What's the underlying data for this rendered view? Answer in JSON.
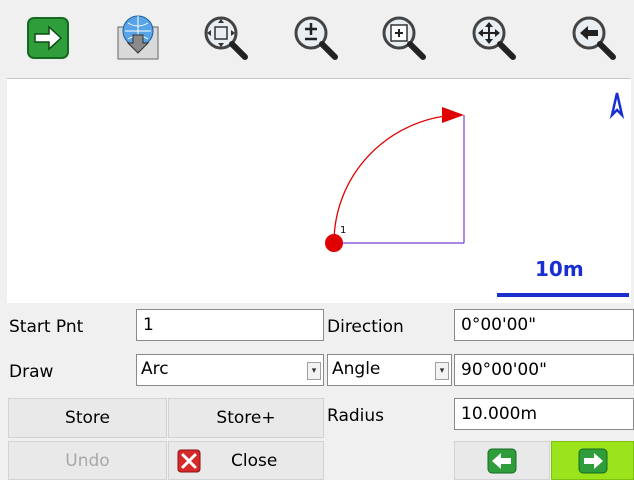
{
  "toolbar": {
    "buttons": [
      {
        "name": "forward-arrow-icon"
      },
      {
        "name": "download-globe-icon"
      },
      {
        "name": "zoom-extents-icon"
      },
      {
        "name": "zoom-in-out-icon"
      },
      {
        "name": "zoom-window-icon"
      },
      {
        "name": "pan-icon"
      },
      {
        "name": "zoom-previous-icon"
      }
    ]
  },
  "map": {
    "point_label": "1",
    "scale_label": "10m",
    "north_symbol_color": "#1a2fd0",
    "arc_color": "#e00000",
    "line_color": "#7b3fd6"
  },
  "form": {
    "start_pnt_label": "Start Pnt",
    "start_pnt_value": "1",
    "direction_label": "Direction",
    "direction_value": "0°00'00\"",
    "draw_label": "Draw",
    "draw_value": "Arc",
    "angle_type_value": "Angle",
    "angle_value": "90°00'00\"",
    "radius_label": "Radius",
    "radius_value": "10.000m"
  },
  "buttons": {
    "store": "Store",
    "store_plus": "Store+",
    "undo": "Undo",
    "close": "Close"
  },
  "colors": {
    "accent_green": "#9be41c",
    "close_red": "#d62a2a"
  }
}
